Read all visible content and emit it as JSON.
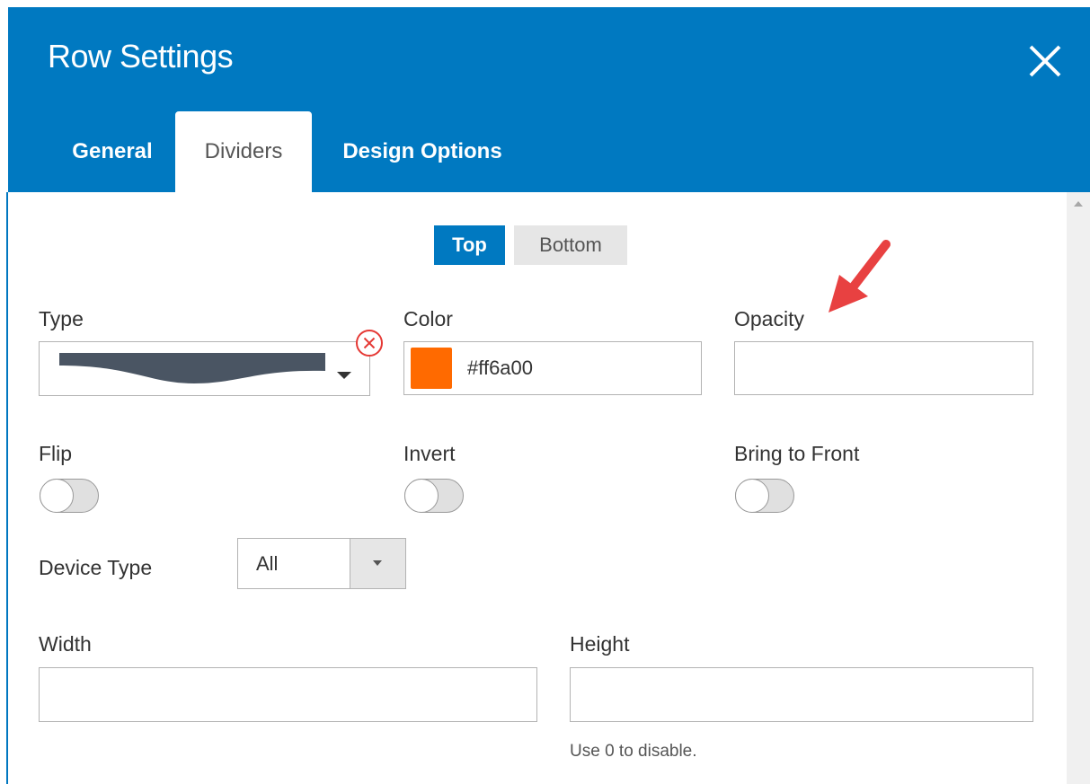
{
  "dialog": {
    "title": "Row Settings",
    "close_icon": "close-icon"
  },
  "tabs": [
    {
      "label": "General",
      "active": false
    },
    {
      "label": "Dividers",
      "active": true
    },
    {
      "label": "Design Options",
      "active": false
    }
  ],
  "position_toggle": {
    "top_label": "Top",
    "bottom_label": "Bottom",
    "selected": "Top"
  },
  "fields": {
    "type": {
      "label": "Type",
      "preview_icon": "wave-divider-icon",
      "clear_icon": "clear-circle-icon"
    },
    "color": {
      "label": "Color",
      "value": "#ff6a00",
      "swatch_color": "#ff6a00"
    },
    "opacity": {
      "label": "Opacity",
      "value": ""
    },
    "flip": {
      "label": "Flip",
      "checked": false
    },
    "invert": {
      "label": "Invert",
      "checked": false
    },
    "bring_to_front": {
      "label": "Bring to Front",
      "checked": false
    },
    "device_type": {
      "label": "Device Type",
      "value": "All"
    },
    "width": {
      "label": "Width",
      "value": ""
    },
    "height": {
      "label": "Height",
      "value": "",
      "hint": "Use 0 to disable."
    }
  },
  "colors": {
    "header_blue": "#0079c1",
    "annotation_red": "#e84141"
  }
}
